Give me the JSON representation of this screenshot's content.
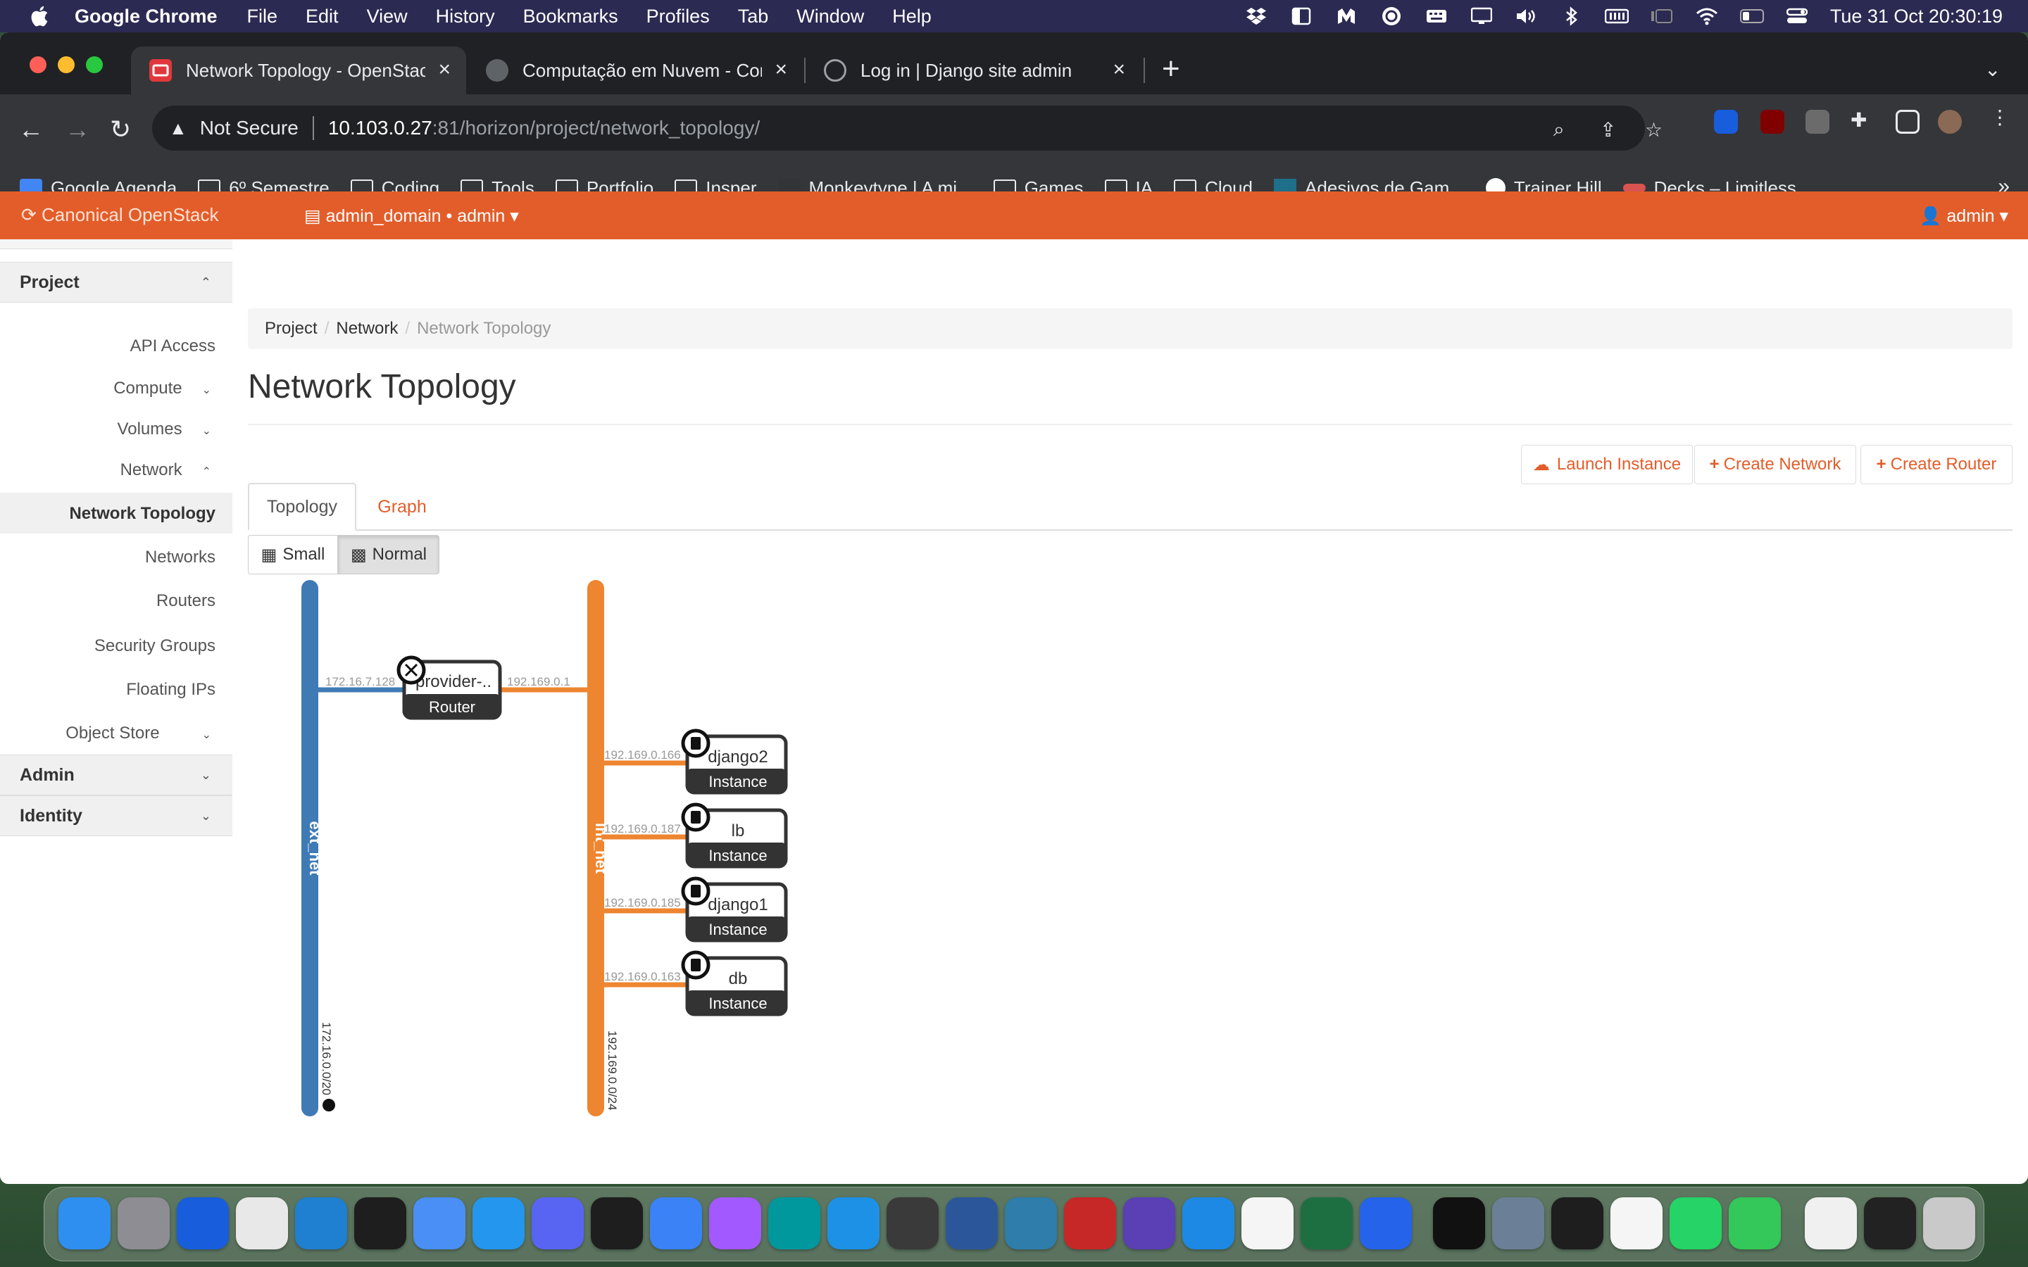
{
  "menubar": {
    "app": "Google Chrome",
    "items": [
      "File",
      "Edit",
      "View",
      "History",
      "Bookmarks",
      "Profiles",
      "Tab",
      "Window",
      "Help"
    ],
    "clock": "Tue 31 Oct  20:30:19"
  },
  "tabs": [
    {
      "title": "Network Topology - OpenStac",
      "active": true
    },
    {
      "title": "Computação em Nuvem - Con",
      "active": false
    },
    {
      "title": "Log in | Django site admin",
      "active": false
    }
  ],
  "address": {
    "security": "Not Secure",
    "host": "10.103.0.27",
    "path": ":81/horizon/project/network_topology/"
  },
  "bookmarks": [
    {
      "label": "Google Agenda",
      "icon": "calendar-icon"
    },
    {
      "label": "6º Semestre",
      "icon": "folder-icon"
    },
    {
      "label": "Coding",
      "icon": "folder-icon"
    },
    {
      "label": "Tools",
      "icon": "folder-icon"
    },
    {
      "label": "Portfolio",
      "icon": "folder-icon"
    },
    {
      "label": "Insper",
      "icon": "folder-icon"
    },
    {
      "label": "Monkeytype | A mi...",
      "icon": "monkeytype-icon"
    },
    {
      "label": "Games",
      "icon": "folder-icon"
    },
    {
      "label": "IA",
      "icon": "folder-icon"
    },
    {
      "label": "Cloud",
      "icon": "folder-icon"
    },
    {
      "label": "Adesivos de Gam...",
      "icon": "sticker-icon"
    },
    {
      "label": "Trainer Hill",
      "icon": "trainer-icon"
    },
    {
      "label": "Decks – Limitless",
      "icon": "decks-icon"
    }
  ],
  "header": {
    "brand": "Canonical OpenStack",
    "project": "admin_domain • admin",
    "user": "admin"
  },
  "sidebar": {
    "project": "Project",
    "admin": "Admin",
    "identity": "Identity",
    "items": {
      "api": "API Access",
      "compute": "Compute",
      "volumes": "Volumes",
      "network": "Network",
      "topology": "Network Topology",
      "networks": "Networks",
      "routers": "Routers",
      "secgroups": "Security Groups",
      "floating": "Floating IPs",
      "objstore": "Object Store"
    }
  },
  "breadcrumb": {
    "project": "Project",
    "network": "Network",
    "current": "Network Topology"
  },
  "page": {
    "title": "Network Topology",
    "launch": "Launch Instance",
    "create_network": "Create Network",
    "create_router": "Create Router",
    "tab_topology": "Topology",
    "tab_graph": "Graph",
    "small": "Small",
    "normal": "Normal"
  },
  "topology": {
    "ext_net": {
      "name": "ext_net",
      "cidr": "172.16.0.0/20",
      "color": "#3f7ab5"
    },
    "int_net": {
      "name": "int_net",
      "cidr": "192.169.0.0/24",
      "color": "#ee8530"
    },
    "router": {
      "name": "provider-..",
      "type": "Router",
      "ext_ip": "172.16.7.128",
      "int_ip": "192.169.0.1"
    },
    "instances": [
      {
        "name": "django2",
        "type": "Instance",
        "ip": "192.169.0.166"
      },
      {
        "name": "lb",
        "type": "Instance",
        "ip": "192.169.0.187"
      },
      {
        "name": "django1",
        "type": "Instance",
        "ip": "192.169.0.185"
      },
      {
        "name": "db",
        "type": "Instance",
        "ip": "192.169.0.163"
      }
    ]
  },
  "dock": [
    "finder",
    "launchpad",
    "bitwarden",
    "chrome",
    "vscode",
    "terminal",
    "xcode",
    "docker-desktop",
    "discord",
    "logitech",
    "cloudflare-warp",
    "figma",
    "arduino",
    "docker",
    "obs",
    "word",
    "mysql-workbench",
    "rocketsim",
    "bezel",
    "dolphin",
    "clock",
    "excel",
    "malwarebytes",
    "epic-games",
    "preview",
    "terminal-2",
    "textedit",
    "whatsapp",
    "numbers",
    "document",
    "screenshot",
    "trash"
  ]
}
